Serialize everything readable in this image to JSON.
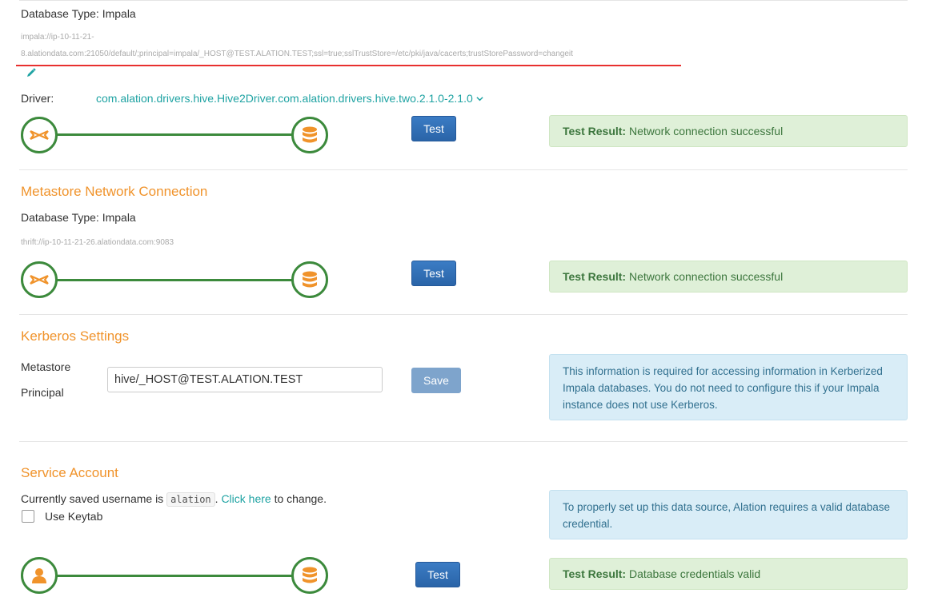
{
  "impala": {
    "db_type": "Database Type: Impala",
    "url_line1": "impala://ip-10-11-21-",
    "url_line2": "8.alationdata.com:21050/default/;principal=impala/_HOST@TEST.ALATION.TEST;ssl=true;sslTrustStore=/etc/pki/java/cacerts;trustStorePassword=changeit",
    "driver_label": "Driver:",
    "driver_value": "com.alation.drivers.hive.Hive2Driver.com.alation.drivers.hive.two.2.1.0-2.1.0",
    "test_label": "Test",
    "result_prefix": "Test Result:",
    "result_text": "Network connection successful"
  },
  "metastore": {
    "title": "Metastore Network Connection",
    "db_type": "Database Type: Impala",
    "uri": "thrift://ip-10-11-21-26.alationdata.com:9083",
    "test_label": "Test",
    "result_prefix": "Test Result:",
    "result_text": "Network connection successful"
  },
  "kerberos": {
    "title": "Kerberos Settings",
    "principal_label_1": "Metastore",
    "principal_label_2": "Principal",
    "principal_value": "hive/_HOST@TEST.ALATION.TEST",
    "save_label": "Save",
    "info_text": "This information is required for accessing information in Kerberized Impala databases. You do not need to configure this if your Impala instance does not use Kerberos."
  },
  "service_account": {
    "title": "Service Account",
    "saved_prefix": "Currently saved username is",
    "username": "alation",
    "link_text": "Click here",
    "saved_suffix": "to change.",
    "keytab_label": "Use Keytab",
    "keytab_checked": false,
    "info_text": "To properly set up this data source, Alation requires a valid database credential.",
    "test_label": "Test",
    "result_prefix": "Test Result:",
    "result_text": "Database credentials valid"
  },
  "colors": {
    "accent_orange": "#f0932b",
    "success_green": "#3c8a3c",
    "link_teal": "#1fa3a3",
    "button_blue": "#2a64a8",
    "underline_red": "#e8302f"
  },
  "icons": [
    "connector-icon",
    "database-icon",
    "user-icon",
    "pencil-icon",
    "chevron-down-icon"
  ]
}
